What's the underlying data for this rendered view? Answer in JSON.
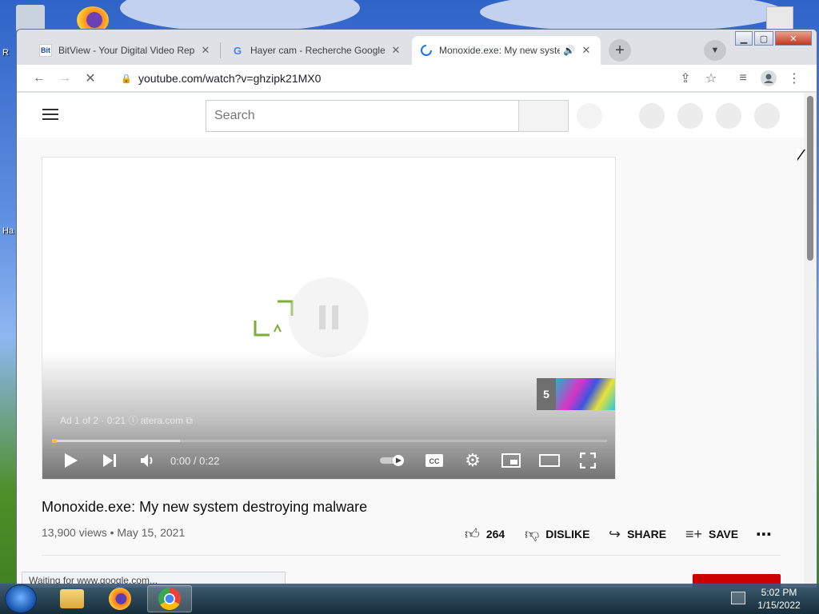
{
  "tabs": [
    {
      "title": "BitView - Your Digital Video Repo",
      "favicon": "bitview-icon",
      "favicon_text": "Bit"
    },
    {
      "title": "Hayer cam - Recherche Google",
      "favicon": "google-icon",
      "favicon_text": "G"
    },
    {
      "title": "Monoxide.exe: My new syste",
      "favicon": "loading-spinner-icon",
      "audio": "speaker-icon"
    }
  ],
  "address": {
    "url": "youtube.com/watch?v=ghzipk21MX0"
  },
  "youtube": {
    "search_placeholder": "Search",
    "player": {
      "ad_count": "5",
      "ad_info": "Ad 1 of 2 · 0:21 ⓘ  atera.com ⧉",
      "time": "0:00 / 0:22",
      "progress_fraction": 0.23
    },
    "video": {
      "title": "Monoxide.exe: My new system destroying malware",
      "meta": "13,900 views • May 15, 2021",
      "likes": "264",
      "dislike_label": "DISLIKE",
      "share_label": "SHARE",
      "save_label": "SAVE"
    }
  },
  "status_bar": "Waiting for www.google.com...",
  "desktop": {
    "left_label_1": "R",
    "left_label_2": "Ha"
  },
  "taskbar": {
    "time": "5:02 PM",
    "date": "1/15/2022"
  },
  "colors": {
    "chrome_tabbar": "#dee1e6",
    "yt_red": "#cc0000",
    "google_blue": "#4285f4"
  }
}
